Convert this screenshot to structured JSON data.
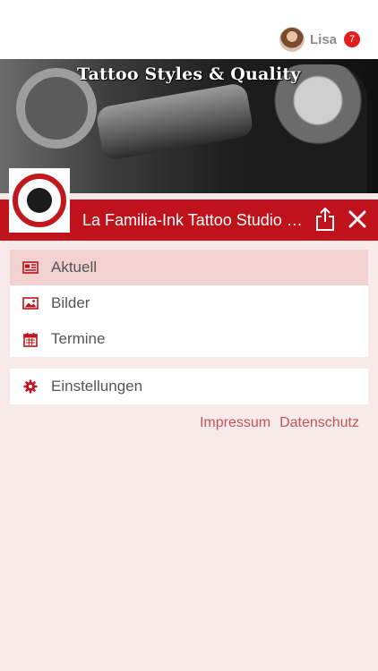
{
  "header": {
    "user_name": "Lisa",
    "notification_count": "7"
  },
  "banner": {
    "title": "Tattoo Styles & Quality"
  },
  "studio": {
    "name": "La Familia-Ink Tattoo Studio L..."
  },
  "menu": {
    "items": [
      {
        "label": "Aktuell",
        "icon": "newspaper-icon"
      },
      {
        "label": "Bilder",
        "icon": "image-icon"
      },
      {
        "label": "Termine",
        "icon": "calendar-icon"
      }
    ],
    "settings": {
      "label": "Einstellungen",
      "icon": "gear-icon"
    }
  },
  "footer": {
    "impressum": "Impressum",
    "datenschutz": "Datenschutz"
  },
  "colors": {
    "accent": "#c0121a",
    "background": "#f9eaea",
    "active_row": "#f2d1d1",
    "link": "#c0545a"
  }
}
